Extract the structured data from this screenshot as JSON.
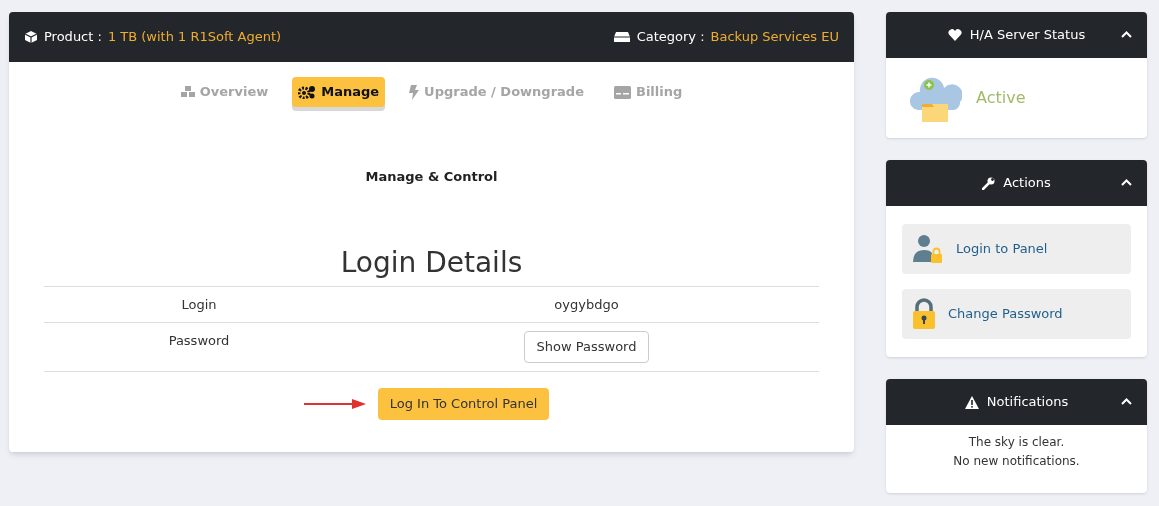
{
  "product": {
    "label": "Product :",
    "value": "1 TB (with 1 R1Soft Agent)"
  },
  "category": {
    "label": "Category :",
    "value": "Backup Services EU"
  },
  "tabs": [
    {
      "label": "Overview",
      "kind": "cubes",
      "selected": false
    },
    {
      "label": "Manage",
      "kind": "gears",
      "selected": true
    },
    {
      "label": "Upgrade / Downgrade",
      "kind": "bolt",
      "selected": false
    },
    {
      "label": "Billing",
      "kind": "card",
      "selected": false
    }
  ],
  "section_title": "Manage & Control",
  "login_details": {
    "title": "Login Details",
    "rows": [
      {
        "label": "Login",
        "value": "oygybdgo",
        "kind": "text"
      },
      {
        "label": "Password",
        "value": "Show Password",
        "kind": "button"
      }
    ],
    "action": "Log In To Control Panel"
  },
  "panels": [
    {
      "title": "H/A Server Status",
      "kind": "status",
      "status": "Active"
    },
    {
      "title": "Actions",
      "kind": "actions",
      "items": [
        {
          "label": "Login to Panel",
          "kind": "user-lock"
        },
        {
          "label": "Change Password",
          "kind": "lock"
        }
      ]
    },
    {
      "title": "Notifications",
      "kind": "notes",
      "lines": [
        "The sky is clear.",
        "No new notifications."
      ]
    }
  ]
}
